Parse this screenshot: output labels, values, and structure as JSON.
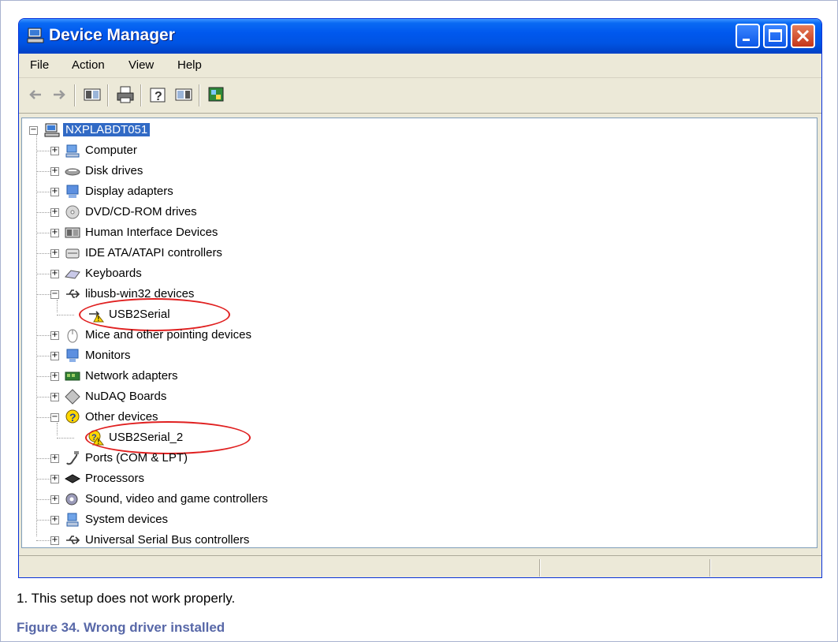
{
  "window": {
    "title": "Device Manager",
    "title_icon": "computer-icon",
    "controls": [
      "minimize-icon",
      "maximize-icon",
      "close-icon"
    ]
  },
  "menu": [
    "File",
    "Action",
    "View",
    "Help"
  ],
  "toolbar": [
    "back-arrow-icon",
    "forward-arrow-icon",
    "show-hide-tree-icon",
    "print-icon",
    "help-icon",
    "properties-icon",
    "scan-hardware-icon"
  ],
  "tree": {
    "root": "NXPLABDT051",
    "items": [
      {
        "label": "Computer",
        "icon": "computer-icon"
      },
      {
        "label": "Disk drives",
        "icon": "disk-drive-icon"
      },
      {
        "label": "Display adapters",
        "icon": "display-adapter-icon"
      },
      {
        "label": "DVD/CD-ROM drives",
        "icon": "dvd-drive-icon"
      },
      {
        "label": "Human Interface Devices",
        "icon": "hid-icon"
      },
      {
        "label": "IDE ATA/ATAPI controllers",
        "icon": "ide-controller-icon"
      },
      {
        "label": "Keyboards",
        "icon": "keyboard-icon"
      },
      {
        "label": "libusb-win32 devices",
        "icon": "usb-icon",
        "expanded": true,
        "children": [
          {
            "label": "USB2Serial",
            "icon": "usb-warning-icon"
          }
        ]
      },
      {
        "label": "Mice and other pointing devices",
        "icon": "mouse-icon"
      },
      {
        "label": "Monitors",
        "icon": "monitor-icon"
      },
      {
        "label": "Network adapters",
        "icon": "network-adapter-icon"
      },
      {
        "label": "NuDAQ Boards",
        "icon": "board-icon"
      },
      {
        "label": "Other devices",
        "icon": "unknown-device-icon",
        "expanded": true,
        "children": [
          {
            "label": "USB2Serial_2",
            "icon": "unknown-warning-icon"
          }
        ]
      },
      {
        "label": "Ports (COM & LPT)",
        "icon": "port-icon"
      },
      {
        "label": "Processors",
        "icon": "processor-icon"
      },
      {
        "label": "Sound, video and game controllers",
        "icon": "sound-icon"
      },
      {
        "label": "System devices",
        "icon": "system-device-icon"
      },
      {
        "label": "Universal Serial Bus controllers",
        "icon": "usb-icon"
      }
    ]
  },
  "note": "1.  This setup does not work properly.",
  "figure_caption": "Figure 34.  Wrong driver installed",
  "colors": {
    "highlight_oval": "#e02020",
    "caption": "#5868a8",
    "selection": "#316ac5"
  }
}
